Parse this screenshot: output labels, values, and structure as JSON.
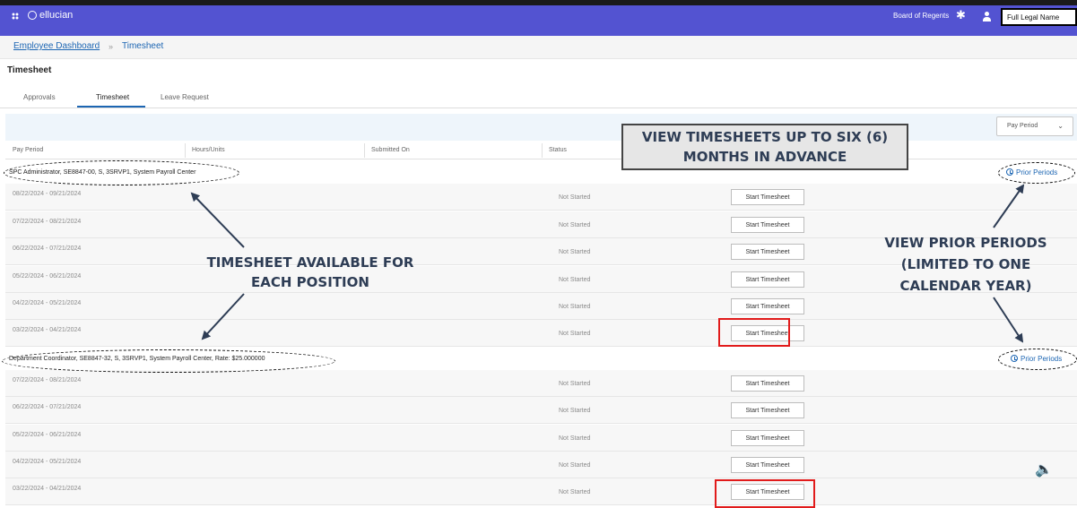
{
  "app": {
    "logo_text": "ellucian",
    "org_label": "Board of Regents",
    "user_name_box": "Full Legal Name"
  },
  "breadcrumb": {
    "parent": "Employee Dashboard",
    "separator": "»",
    "current": "Timesheet"
  },
  "page_title": "Timesheet",
  "tabs": [
    {
      "label": "Approvals",
      "active": false
    },
    {
      "label": "Timesheet",
      "active": true
    },
    {
      "label": "Leave Request",
      "active": false
    }
  ],
  "filter": {
    "selected": "Pay Period"
  },
  "table": {
    "headers": [
      "Pay Period",
      "Hours/Units",
      "Submitted On",
      "Status"
    ],
    "status_text": "Not Started",
    "action_label": "Start Timesheet",
    "prior_label": "Prior Periods"
  },
  "positions": [
    {
      "title": "SPC Administrator, SE8847-00, S, 3SRVP1, System Payroll Center",
      "periods": [
        "08/22/2024 - 09/21/2024",
        "07/22/2024 - 08/21/2024",
        "06/22/2024 - 07/21/2024",
        "05/22/2024 - 06/21/2024",
        "04/22/2024 - 05/21/2024",
        "03/22/2024 - 04/21/2024"
      ]
    },
    {
      "title": "Department Coordinator, SE8847-32, S, 3SRVP1, System Payroll Center, Rate: $25.000000",
      "periods": [
        "07/22/2024 - 08/21/2024",
        "06/22/2024 - 07/21/2024",
        "05/22/2024 - 06/21/2024",
        "04/22/2024 - 05/21/2024",
        "03/22/2024 - 04/21/2024"
      ]
    }
  ],
  "annotations": {
    "advance_line1": "VIEW TIMESHEETS UP TO SIX (6)",
    "advance_line2": "MONTHS IN ADVANCE",
    "position_line1": "TIMESHEET AVAILABLE FOR",
    "position_line2": "EACH POSITION",
    "prior_line1": "VIEW PRIOR PERIODS",
    "prior_line2": "(LIMITED TO ONE",
    "prior_line3": "CALENDAR YEAR)"
  },
  "icons": {
    "grid": "grid-icon",
    "logo": "ellucian-logo-icon",
    "settings": "gear-icon",
    "user": "user-icon",
    "history": "history-icon",
    "chevron": "chevron-down-icon",
    "speaker": "speaker-icon"
  },
  "colors": {
    "header_bg": "#5353d1",
    "link": "#1d66b3",
    "highlight": "#e11b1b",
    "annotation_text": "#2e3d55"
  }
}
